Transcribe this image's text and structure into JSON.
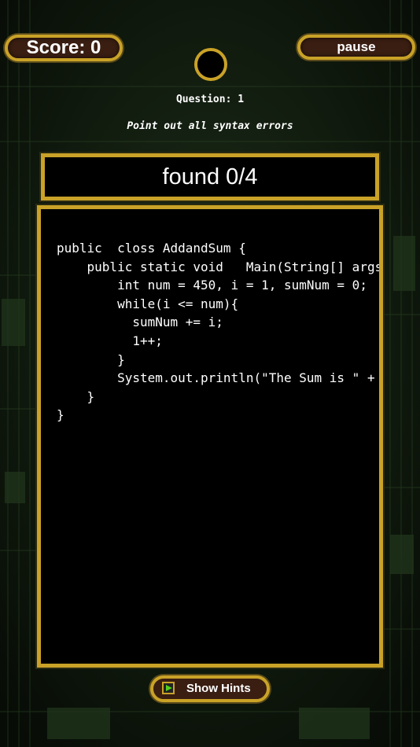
{
  "hud": {
    "score_label": "Score: 0",
    "pause_label": "pause"
  },
  "question": {
    "title": "Question: 1",
    "instruction": "Point out all syntax errors",
    "found": "found 0/4"
  },
  "code": {
    "lines": [
      "public  closs AddandSum {",
      "    public static void   Main(String[] args){",
      "        int num = 450, i = 1, sumNum = 0;",
      "        while(i <= num){",
      "          sumNum += i;",
      "          1++;",
      "        }",
      "        System.out.println(\"The Sum is \" + sumNum);",
      "    }",
      "}"
    ]
  },
  "hints": {
    "label": "Show Hints"
  },
  "colors": {
    "gold": "#c9a227",
    "button_fill": "#3a1e12",
    "background": "#0f1a0d",
    "play_green": "#4fd11c"
  },
  "icons": {
    "timer": "timer-ring-icon",
    "hint": "play-icon"
  }
}
